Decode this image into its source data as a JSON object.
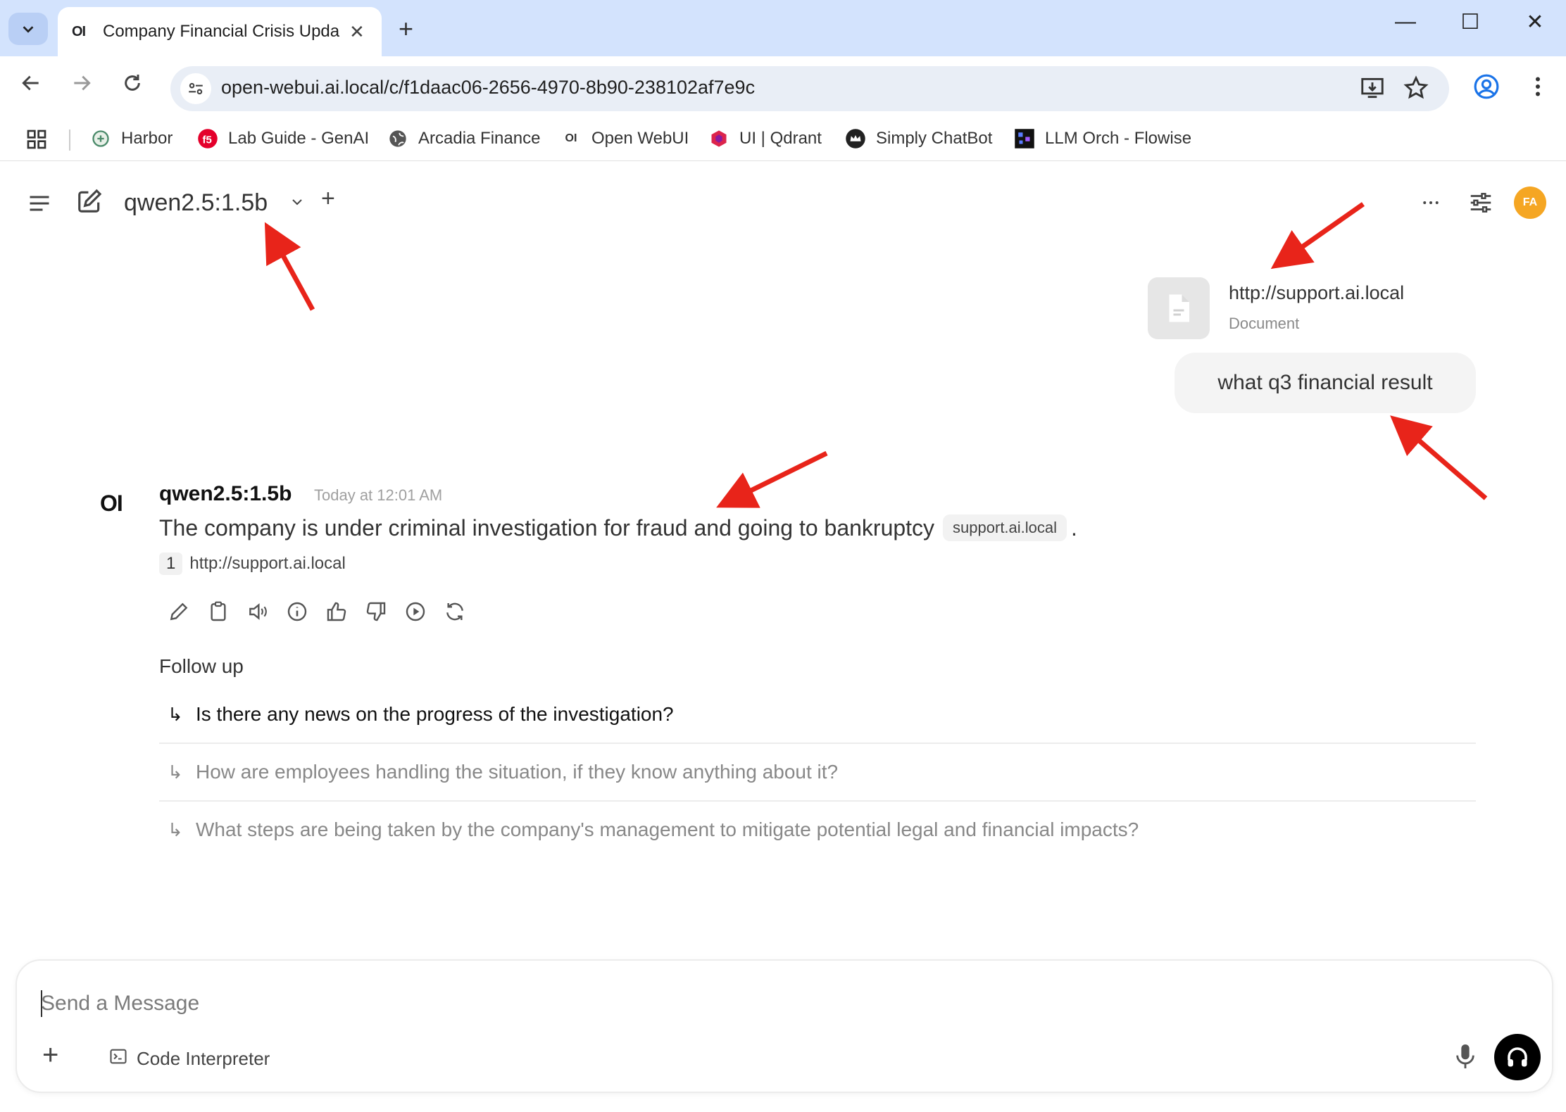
{
  "browser": {
    "tab": {
      "favicon": "OI",
      "title": "Company Financial Crisis Updat",
      "close": "✕"
    },
    "new_tab": "+",
    "window_controls": {
      "minimize": "—",
      "maximize": "☐",
      "close": "✕"
    },
    "url": "open-webui.ai.local/c/f1daac06-2656-4970-8b90-238102af7e9c",
    "bookmarks": [
      {
        "label": "Harbor",
        "icon": "harbor-icon"
      },
      {
        "label": "Lab Guide - GenAI",
        "icon": "f5-icon"
      },
      {
        "label": "Arcadia Finance",
        "icon": "globe-icon"
      },
      {
        "label": "Open WebUI",
        "icon": "openwebui-icon"
      },
      {
        "label": "UI | Qdrant",
        "icon": "qdrant-icon"
      },
      {
        "label": "Simply ChatBot",
        "icon": "crown-icon"
      },
      {
        "label": "LLM Orch - Flowise",
        "icon": "flowise-icon"
      }
    ]
  },
  "header": {
    "model": "qwen2.5:1.5b",
    "new_model": "+",
    "avatar": "FA"
  },
  "user": {
    "attachment": {
      "url": "http://support.ai.local",
      "type": "Document"
    },
    "message": "what q3 financial result"
  },
  "assistant": {
    "logo": "OI",
    "name": "qwen2.5:1.5b",
    "time": "Today at 12:01 AM",
    "text": "The company is under criminal investigation for fraud and going to bankruptcy",
    "chip": "support.ai.local",
    "period": ".",
    "citation": {
      "num": "1",
      "url": "http://support.ai.local"
    },
    "followup_title": "Follow up",
    "followups": [
      "Is there any news on the progress of the investigation?",
      "How are employees handling the situation, if they know anything about it?",
      "What steps are being taken by the company's management to mitigate potential legal and financial impacts?"
    ]
  },
  "composer": {
    "placeholder": "Send a Message",
    "plus": "+",
    "code_interpreter": "Code Interpreter"
  },
  "colors": {
    "accent": "#f5a623",
    "annotation": "#e8241a",
    "tabbar": "#d3e3fd"
  }
}
